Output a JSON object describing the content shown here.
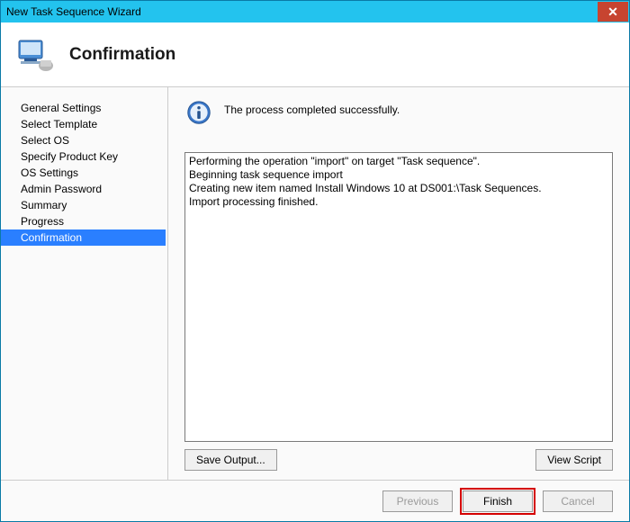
{
  "window": {
    "title": "New Task Sequence Wizard"
  },
  "header": {
    "page_title": "Confirmation"
  },
  "sidebar": {
    "items": [
      {
        "label": "General Settings",
        "selected": false
      },
      {
        "label": "Select Template",
        "selected": false
      },
      {
        "label": "Select OS",
        "selected": false
      },
      {
        "label": "Specify Product Key",
        "selected": false
      },
      {
        "label": "OS Settings",
        "selected": false
      },
      {
        "label": "Admin Password",
        "selected": false
      },
      {
        "label": "Summary",
        "selected": false
      },
      {
        "label": "Progress",
        "selected": false
      },
      {
        "label": "Confirmation",
        "selected": true
      }
    ]
  },
  "main": {
    "status_message": "The process completed successfully.",
    "log_text": "Performing the operation \"import\" on target \"Task sequence\".\nBeginning task sequence import\nCreating new item named Install Windows 10 at DS001:\\Task Sequences.\nImport processing finished.",
    "save_output_label": "Save Output...",
    "view_script_label": "View Script"
  },
  "footer": {
    "previous_label": "Previous",
    "finish_label": "Finish",
    "cancel_label": "Cancel",
    "previous_enabled": false,
    "cancel_enabled": false
  }
}
